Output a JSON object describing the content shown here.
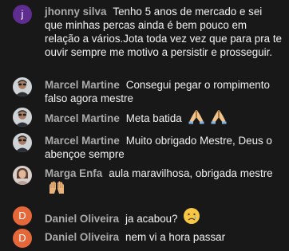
{
  "chat": {
    "messages": [
      {
        "author": "jhonny silva",
        "avatar": {
          "type": "letter",
          "letter": "j",
          "color": "#5e2d8f"
        },
        "text": "Tenho 5 anos de mercado e sei que minhas percas ainda é bem pouco em relação a vários.Jota toda vez vez que para pra te ouvir sempre me motivo a persistir e prosseguir.",
        "emojis": []
      },
      {
        "author": "Marcel Martine",
        "avatar": {
          "type": "image",
          "icon": "user-photo-avatar"
        },
        "text": "Consegui pegar o rompimento falso agora mestre",
        "emojis": []
      },
      {
        "author": "Marcel Martine",
        "avatar": {
          "type": "image",
          "icon": "user-photo-avatar"
        },
        "text": "Meta batida",
        "emojis": [
          "folded-hands-emoji",
          "folded-hands-emoji"
        ]
      },
      {
        "author": "Marcel Martine",
        "avatar": {
          "type": "image",
          "icon": "user-photo-avatar"
        },
        "text": "Muito obrigado Mestre, Deus o abençoe sempre",
        "emojis": []
      },
      {
        "author": "Marga Enfa",
        "avatar": {
          "type": "image",
          "icon": "user-photo-avatar"
        },
        "text": "aula maravilhosa, obrigada mestre",
        "emojis": [
          "raising-hands-emoji"
        ]
      },
      {
        "author": "Daniel Oliveira",
        "avatar": {
          "type": "letter",
          "letter": "D",
          "color": "#e4683a"
        },
        "text": "ja acabou?",
        "emojis": [
          "crying-face-emoji"
        ]
      },
      {
        "author": "Daniel Oliveira",
        "avatar": {
          "type": "letter",
          "letter": "D",
          "color": "#e4683a"
        },
        "text": "nem vi a hora passar",
        "emojis": []
      }
    ]
  },
  "colors": {
    "background": "#181818",
    "author": "#aaaaaa",
    "text": "#f1f1f1"
  }
}
